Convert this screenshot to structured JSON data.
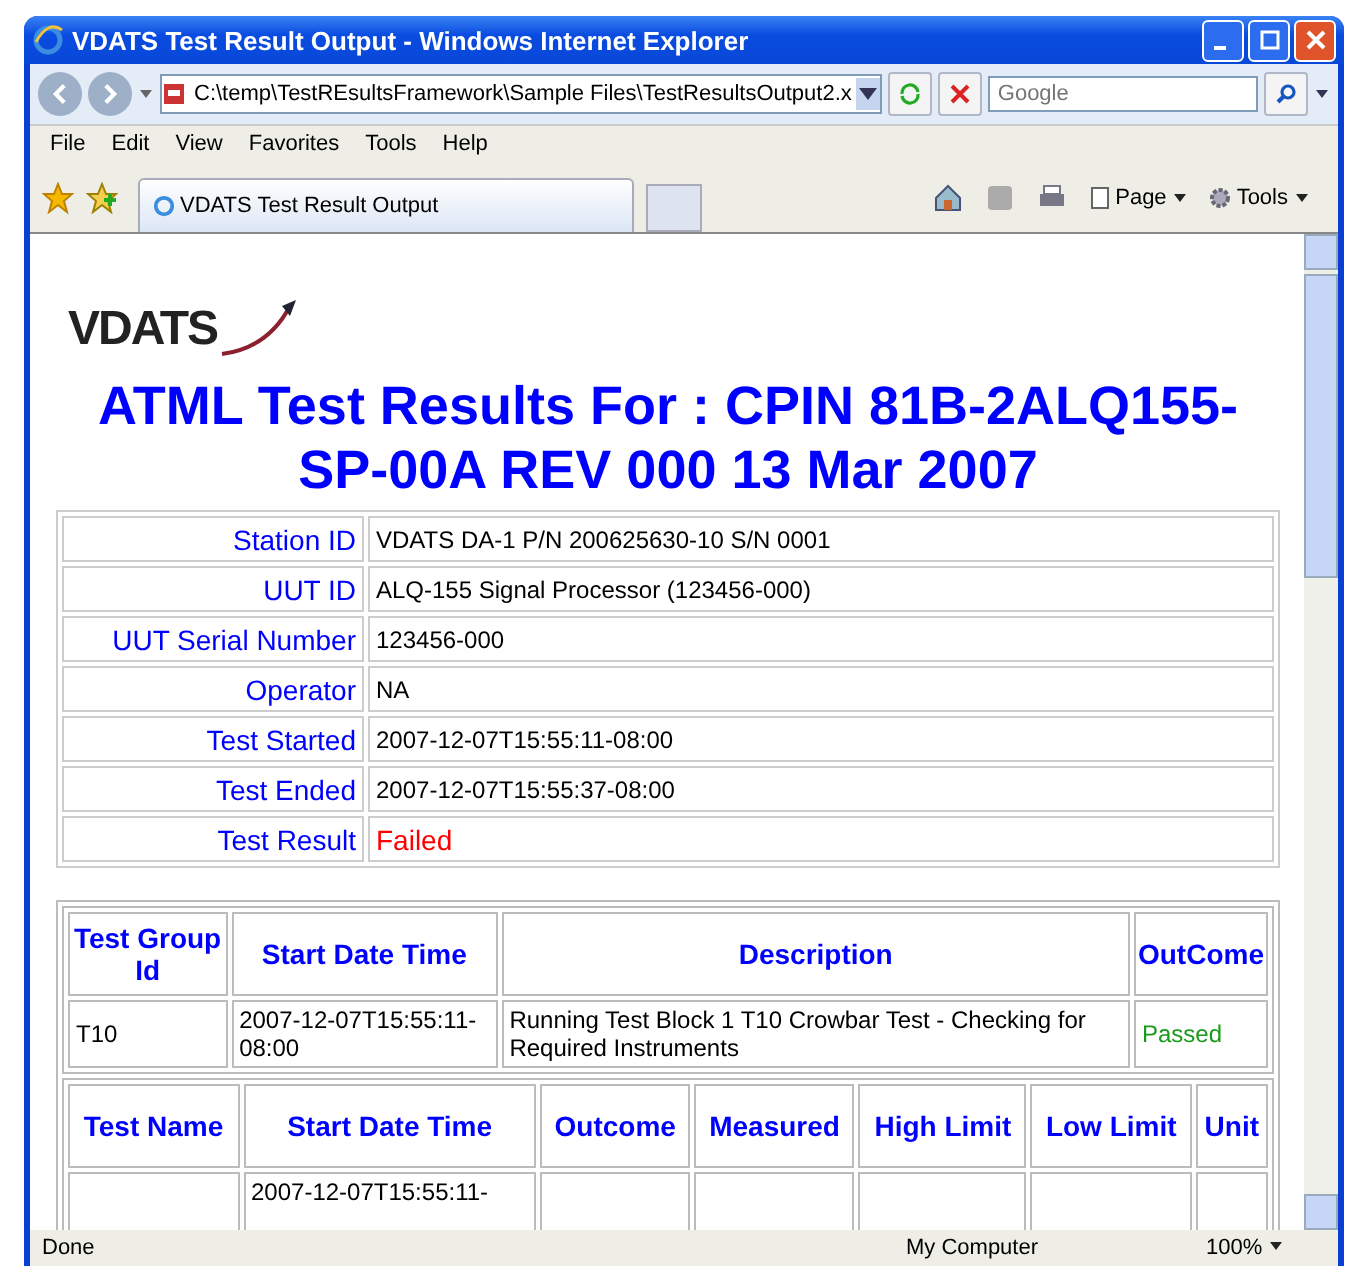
{
  "window": {
    "title": "VDATS Test Result Output - Windows Internet Explorer"
  },
  "address": {
    "value": "C:\\temp\\TestREsultsFramework\\Sample Files\\TestResultsOutput2.x"
  },
  "search": {
    "placeholder": "Google"
  },
  "menu": [
    "File",
    "Edit",
    "View",
    "Favorites",
    "Tools",
    "Help"
  ],
  "tabs": [
    {
      "label": "VDATS Test Result Output",
      "selected": true
    }
  ],
  "command_bar": {
    "page": "Page",
    "tools": "Tools"
  },
  "page": {
    "logo": "VDATS",
    "heading": "ATML Test Results For : CPIN 81B-2ALQ155-SP-00A REV 000 13 Mar 2007",
    "info": [
      {
        "label": "Station ID",
        "value": "VDATS DA-1 P/N 200625630-10 S/N 0001",
        "kind": "plain"
      },
      {
        "label": "UUT ID",
        "value": "ALQ-155 Signal Processor (123456-000)",
        "kind": "plain"
      },
      {
        "label": "UUT Serial Number",
        "value": "123456-000",
        "kind": "plain"
      },
      {
        "label": "Operator",
        "value": "NA",
        "kind": "plain"
      },
      {
        "label": "Test Started",
        "value": "2007-12-07T15:55:11-08:00",
        "kind": "plain"
      },
      {
        "label": "Test Ended",
        "value": "2007-12-07T15:55:37-08:00",
        "kind": "plain"
      },
      {
        "label": "Test Result",
        "value": "Failed",
        "kind": "failed"
      }
    ],
    "group_table": {
      "columns": [
        "Test Group Id",
        "Start Date Time",
        "Description",
        "OutCome"
      ],
      "rows": [
        {
          "cells": [
            "T10",
            "2007-12-07T15:55:11-08:00",
            "Running Test Block 1 T10 Crowbar Test - Checking for Required Instruments",
            "Passed"
          ],
          "kind": "passed"
        }
      ]
    },
    "test_table": {
      "columns": [
        "Test Name",
        "Start Date Time",
        "Outcome",
        "Measured",
        "High Limit",
        "Low Limit",
        "Unit"
      ],
      "partial_row": {
        "start_date_time": "2007-12-07T15:55:11-"
      }
    }
  },
  "status_bar": {
    "text": "Done",
    "zone": "My Computer",
    "zoom": "100%"
  }
}
